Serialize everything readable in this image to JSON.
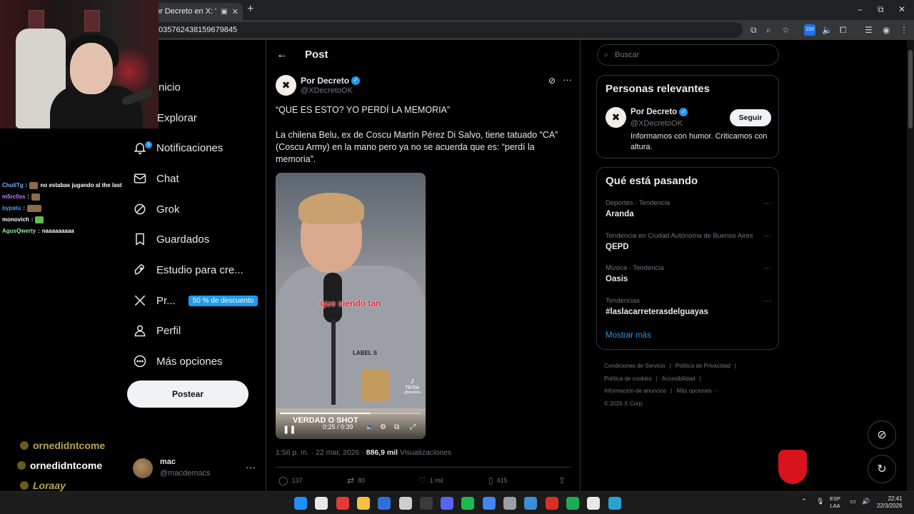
{
  "browser": {
    "tab_title": "or Decreto en X: \"\"QUE",
    "tab_mute_icon": "speaker-icon",
    "tab_close": "✕",
    "new_tab": "+",
    "url": "035762438159679845",
    "window_controls": [
      "–",
      "⧉",
      "✕"
    ],
    "extension_badge": "150"
  },
  "overlay": {
    "chat": [
      {
        "user": "ChuliTg",
        "color": "#6fb3ff",
        "text": "no estabas jugando al the last"
      },
      {
        "user": "m5rc0ss",
        "color": "#c77dff",
        "text": ""
      },
      {
        "user": "bypatu",
        "color": "#4aa3ff",
        "text": ""
      },
      {
        "user": "monovich",
        "color": "#ffffff",
        "text": ""
      },
      {
        "user": "AgusQwerty",
        "color": "#9be7a0",
        "text": "naaaaaaaaa"
      }
    ],
    "subs": [
      {
        "name": "ornedidntcome",
        "color": "#b8a64d"
      },
      {
        "name": "ornedidntcome",
        "color": "#ffffff"
      },
      {
        "name": "Loraay",
        "color": "#b8a64d"
      }
    ]
  },
  "nav": {
    "items": [
      {
        "label": "nicio",
        "icon": "home-icon"
      },
      {
        "label": "Explorar",
        "icon": "search-icon"
      },
      {
        "label": "Notificaciones",
        "icon": "bell-icon",
        "badge": "1"
      },
      {
        "label": "Chat",
        "icon": "mail-icon"
      },
      {
        "label": "Grok",
        "icon": "grok-icon"
      },
      {
        "label": "Guardados",
        "icon": "bookmark-icon"
      },
      {
        "label": "Estudio para cre...",
        "icon": "rocket-icon"
      },
      {
        "label": "Pr...",
        "icon": "x-logo-icon",
        "promo": "50 % de descuento"
      },
      {
        "label": "Perfil",
        "icon": "person-icon"
      },
      {
        "label": "Más opciones",
        "icon": "more-circle-icon"
      }
    ],
    "post_button": "Postear",
    "account": {
      "name": "mac",
      "handle": "@macdemacs",
      "more": "···"
    }
  },
  "main": {
    "title": "Post",
    "tweet": {
      "avatar": "✖",
      "name": "Por Decreto",
      "handle": "@XDecretoOK",
      "line1": "“QUE ES ESTO? YO PERDÍ LA MEMORIA”",
      "line2": "La chilena Belu, ex de Coscu Martín Pérez Di Salvo, tiene tatuado “CA” (Coscu Army) en la mano pero ya no se acuerda que es: “perdí la memoria”.",
      "video": {
        "caption": "que siendo tan",
        "banner": "VERDAD O SHOT",
        "time": "0:25 / 0:39",
        "progress": 0.64,
        "tiktok": "TikTok",
        "tiktok_user": "@teodoka",
        "label": "LABEL S"
      },
      "time": "1:56 p. m. · 22 mar. 2026 · ",
      "views_count": "886,9 mil",
      "views_label": " Visualizaciones",
      "replies": "137",
      "reposts": "80",
      "likes": "1 mil",
      "bookmarks": "415"
    }
  },
  "sidebar": {
    "search_placeholder": "Buscar",
    "relevant": {
      "title": "Personas relevantes",
      "name": "Por Decreto",
      "handle": "@XDecretoOK",
      "follow": "Seguir",
      "bio": "Informamos con humor. Criticamos con altura."
    },
    "trending": {
      "title": "Qué está pasando",
      "items": [
        {
          "category": "Deportes · Tendencia",
          "name": "Aranda"
        },
        {
          "category": "Tendencia en Ciudad Autónoma de Buenos Aires",
          "name": "QEPD"
        },
        {
          "category": "Música · Tendencia",
          "name": "Oasis"
        },
        {
          "category": "Tendencias",
          "name": "#laslacarreterasdelguayas"
        }
      ],
      "show_more": "Mostrar más"
    },
    "footer": {
      "row1": [
        "Condiciones de Servicio",
        "|",
        "Política de Privacidad",
        "|"
      ],
      "row2": [
        "Política de cookies",
        "|",
        "Accesibilidad",
        "|"
      ],
      "row3": [
        "Información de anuncios",
        "|",
        "Más opciones ···"
      ],
      "copyright": "© 2026 X Corp."
    }
  },
  "taskbar": {
    "lang_top": "ESP",
    "lang_bottom": "LAA",
    "time": "22:41",
    "date": "22/3/2026",
    "apps": [
      "#1e90ff",
      "#e8e8e8",
      "#e53935",
      "#f5c242",
      "#2f6fdb",
      "#cfcfcf",
      "#3a3a3a",
      "#5865f2",
      "#1db954",
      "#4285f4",
      "#9aa0a6",
      "#3b8fd9",
      "#d93025",
      "#1faa59",
      "#e8e8e8",
      "#2aa1d6"
    ]
  }
}
